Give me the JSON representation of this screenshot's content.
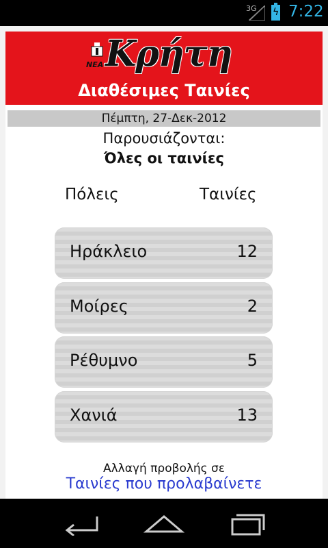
{
  "status_bar": {
    "network": "3G",
    "time": "7:22",
    "icons": [
      "signal-icon",
      "battery-charging-icon"
    ]
  },
  "header": {
    "logo_small": "ΝΕΑ",
    "logo_word": "Κρήτη",
    "title": "Διαθέσιμες Ταινίες"
  },
  "date": "Πέμπτη, 27-Δεκ-2012",
  "showing": {
    "label": "Παρουσιάζονται:",
    "value": "Όλες οι ταινίες"
  },
  "columns": {
    "cities": "Πόλεις",
    "movies": "Ταινίες"
  },
  "cities": [
    {
      "name": "Ηράκλειο",
      "count": "12"
    },
    {
      "name": "Μοίρες",
      "count": "2"
    },
    {
      "name": "Ρέθυμνο",
      "count": "5"
    },
    {
      "name": "Χανιά",
      "count": "13"
    }
  ],
  "switch_view": {
    "label": "Αλλαγή προβολής σε",
    "link": "Ταινίες που προλαβαίνετε"
  },
  "nav": {
    "icons": [
      "back-icon",
      "home-icon",
      "recent-apps-icon"
    ]
  },
  "colors": {
    "brand_red": "#e4141b",
    "accent_blue": "#33b5e5",
    "link_blue": "#2a3bcf"
  }
}
